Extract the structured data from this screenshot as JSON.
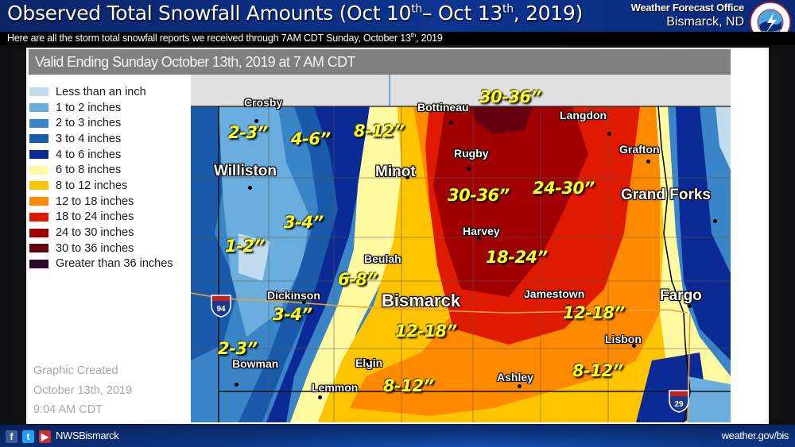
{
  "header": {
    "title_main": "Observed Total Snowfall Amounts (Oct 10",
    "title_sup1": "th",
    "title_mid": "– Oct 13",
    "title_sup2": "th",
    "title_end": ", 2019)",
    "office_line1": "Weather Forecast Office",
    "office_line2": "Bismarck, ND",
    "logo": "nws-logo-icon"
  },
  "subheader": {
    "text": "Here are all the storm total snowfall reports we received through 7AM CDT Sunday, October 13",
    "sup": "th",
    "text_end": ", 2019"
  },
  "panel": {
    "valid_text": "Valid Ending Sunday October 13th, 2019 at 7 AM CDT",
    "created_line1": "Graphic Created",
    "created_line2": "October 13th, 2019",
    "created_line3": "9:04 AM CDT"
  },
  "legend": [
    {
      "label": "Less than an inch",
      "color": "#c2dcee"
    },
    {
      "label": "1 to 2 inches",
      "color": "#6aaee0"
    },
    {
      "label": "2 to 3 inches",
      "color": "#3a84c8"
    },
    {
      "label": "3 to 4 inches",
      "color": "#1a5aaa"
    },
    {
      "label": "4 to 6 inches",
      "color": "#0c2a96"
    },
    {
      "label": "6 to 8 inches",
      "color": "#fffaa0"
    },
    {
      "label": "8 to 12 inches",
      "color": "#ffc400"
    },
    {
      "label": "12 to 18 inches",
      "color": "#ff8a00"
    },
    {
      "label": "18 to 24 inches",
      "color": "#e01a00"
    },
    {
      "label": "24 to 30 inches",
      "color": "#a00000"
    },
    {
      "label": "30 to 36 inches",
      "color": "#640010"
    },
    {
      "label": "Greater than 36 inches",
      "color": "#2a0a2a"
    }
  ],
  "map": {
    "cities": [
      {
        "name": "Crosby",
        "size": "small"
      },
      {
        "name": "Bottineau",
        "size": "small"
      },
      {
        "name": "Langdon",
        "size": "small"
      },
      {
        "name": "Williston",
        "size": "big"
      },
      {
        "name": "Minot",
        "size": "big"
      },
      {
        "name": "Rugby",
        "size": "small"
      },
      {
        "name": "Grafton",
        "size": "small"
      },
      {
        "name": "Grand Forks",
        "size": "big"
      },
      {
        "name": "Harvey",
        "size": "small"
      },
      {
        "name": "Beulah",
        "size": "small"
      },
      {
        "name": "Dickinson",
        "size": "small"
      },
      {
        "name": "Bismarck",
        "size": "huge"
      },
      {
        "name": "Jamestown",
        "size": "small"
      },
      {
        "name": "Fargo",
        "size": "big"
      },
      {
        "name": "Elgin",
        "size": "small"
      },
      {
        "name": "Bowman",
        "size": "small"
      },
      {
        "name": "Lisbon",
        "size": "small"
      },
      {
        "name": "Lemmon",
        "size": "small"
      },
      {
        "name": "Ashley",
        "size": "small"
      }
    ],
    "amounts": [
      "2-3”",
      "4-6”",
      "8-12”",
      "30-36”",
      "30-36”",
      "24-30”",
      "3-4”",
      "1-2”",
      "18-24”",
      "6-8”",
      "3-4”",
      "12-18”",
      "12-18”",
      "2-3”",
      "8-12”",
      "8-12”"
    ],
    "interstates": [
      "94",
      "29"
    ]
  },
  "footer": {
    "social": [
      "facebook-icon",
      "twitter-icon",
      "youtube-icon"
    ],
    "handle": "NWSBismarck",
    "site": "weather.gov/bis"
  }
}
